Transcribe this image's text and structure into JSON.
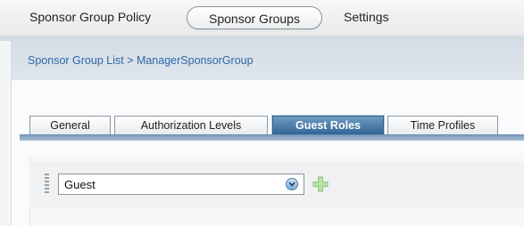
{
  "nav": {
    "items": [
      "Sponsor Group Policy",
      "Sponsor Groups",
      "Settings"
    ],
    "active": "Sponsor Groups"
  },
  "breadcrumb": "Sponsor Group List > ManagerSponsorGroup",
  "tabs": [
    "General",
    "Authorization Levels",
    "Guest Roles",
    "Time Profiles"
  ],
  "active_tab": "Guest Roles",
  "guest_role": {
    "value": "Guest",
    "icons": [
      "drag-handle-icon",
      "chevron-down-icon",
      "plus-icon"
    ]
  },
  "colors": {
    "tab_active": "#2e6394",
    "link": "#2b68a8",
    "plus": "#9bcf86"
  }
}
